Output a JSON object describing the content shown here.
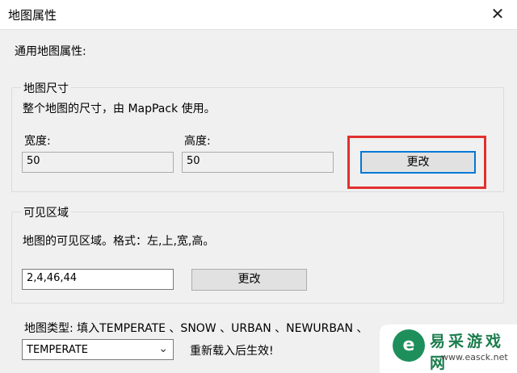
{
  "window": {
    "title": "地图属性",
    "close_glyph": "✕"
  },
  "general_label": "通用地图属性:",
  "map_size": {
    "legend": "地图尺寸",
    "description": "整个地图的尺寸，由 MapPack 使用。",
    "width_label": "宽度:",
    "width_value": "50",
    "height_label": "高度:",
    "height_value": "50",
    "change_button": "更改"
  },
  "visible_area": {
    "legend": "可见区域",
    "description": "地图的可见区域。格式：左,上,宽,高。",
    "value": "2,4,46,44",
    "change_button": "更改"
  },
  "map_type": {
    "label": "地图类型:  填入TEMPERATE 、SNOW 、URBAN 、NEWURBAN 、",
    "selected": "TEMPERATE",
    "note": "重新载入后生效!"
  },
  "watermark": {
    "logo_char": "e",
    "text": "易采游戏网",
    "url": "www.easck.net"
  },
  "colors": {
    "highlight": "#e23030",
    "focus": "#0078d7",
    "brand_green": "#1e8f5b"
  }
}
